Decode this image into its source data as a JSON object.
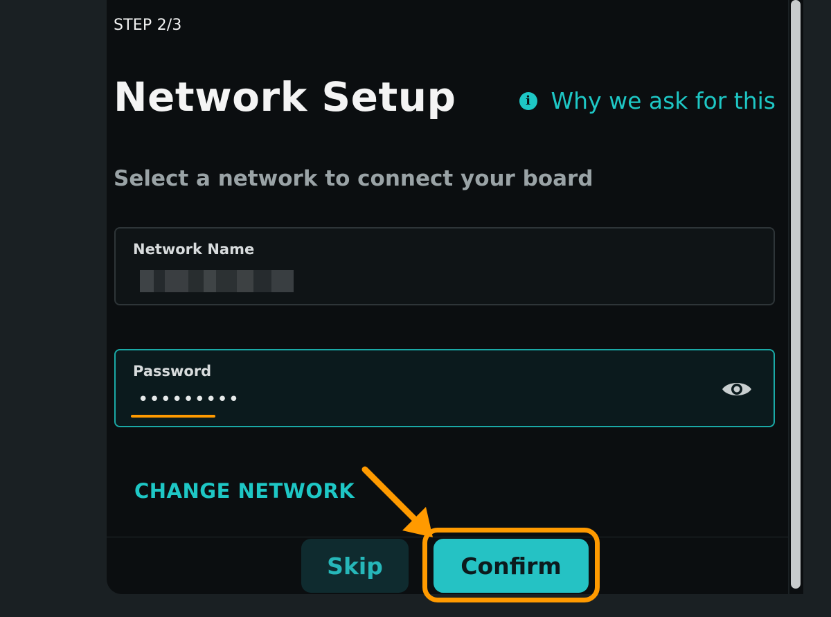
{
  "dialog": {
    "step": "STEP 2/3",
    "title": "Network Setup",
    "why_link": "Why we ask for this",
    "subtitle": "Select a network to connect your board"
  },
  "network_field": {
    "label": "Network Name",
    "value_obscured": true
  },
  "password_field": {
    "label": "Password",
    "value": "•••••••••"
  },
  "change_network_label": "CHANGE NETWORK",
  "buttons": {
    "skip": "Skip",
    "confirm": "Confirm"
  },
  "icons": {
    "info": "info-icon",
    "visibility": "eye-icon"
  },
  "colors": {
    "accent": "#1ec7c5",
    "highlight": "#ff9a00",
    "background": "#0b0e10"
  }
}
